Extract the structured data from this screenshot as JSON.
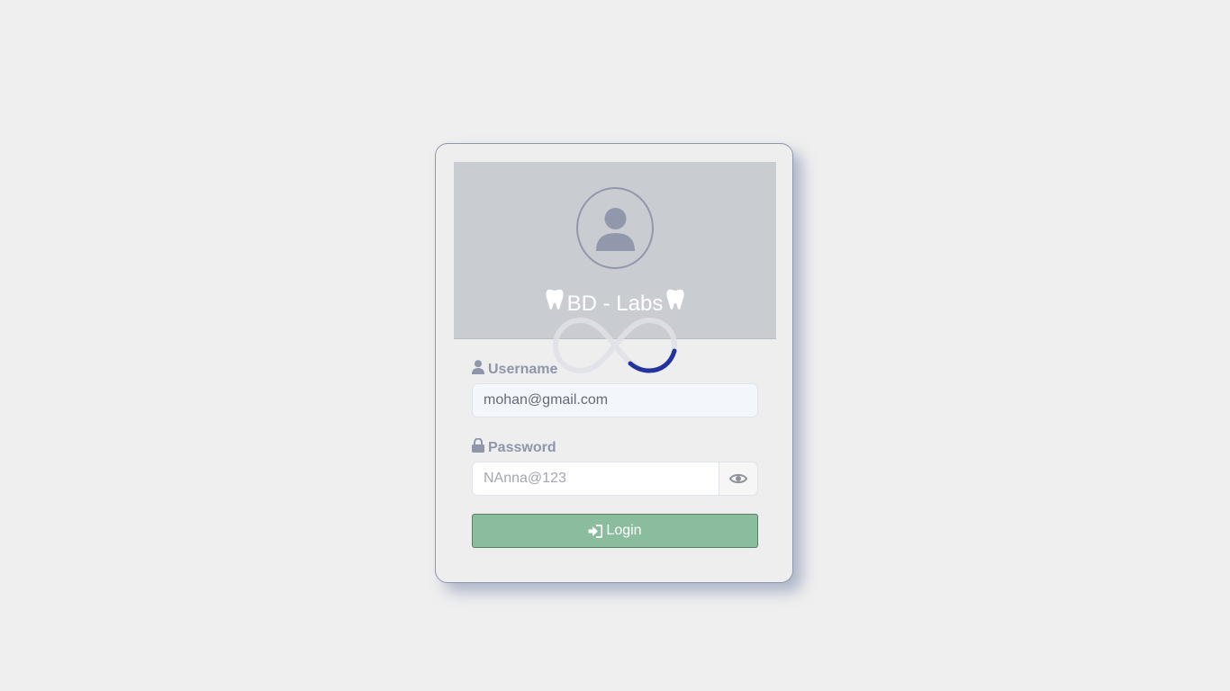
{
  "brand": {
    "title": "BD - Labs"
  },
  "form": {
    "username_label": "Username",
    "username_value": "mohan@gmail.com",
    "password_label": "Password",
    "password_placeholder": "NAnna@123",
    "login_label": "Login"
  },
  "icons": {
    "avatar": "user-circle-icon",
    "brand_left": "tooth-icon",
    "brand_right": "tooth-icon",
    "username": "user-icon",
    "password": "lock-icon",
    "toggle_password": "eye-icon",
    "login": "sign-in-icon",
    "loader": "infinity-loader-icon"
  },
  "colors": {
    "background": "#efefef",
    "card_border": "#8f96aa",
    "header_bg": "#c9cdd2",
    "label": "#8f96aa",
    "login_button": "#8abd9d",
    "loader_accent": "#2432a0"
  }
}
